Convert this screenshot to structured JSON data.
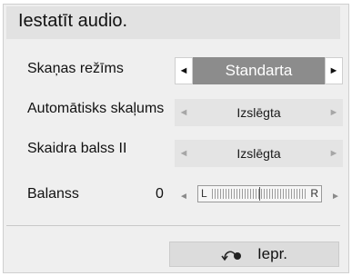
{
  "dialog": {
    "title": "Iestatīt audio."
  },
  "settings": [
    {
      "label": "Skaņas režīms",
      "value": "Standarta",
      "active": true
    },
    {
      "label": "Automātisks skaļums",
      "value": "Izslēgta",
      "active": false
    },
    {
      "label": "Skaidra balss II",
      "value": "Izslēgta",
      "active": false
    }
  ],
  "balance": {
    "label": "Balanss",
    "value": "0",
    "left_label": "L",
    "right_label": "R"
  },
  "arrows": {
    "left": "◄",
    "right": "►"
  },
  "footer": {
    "back_label": "Iepr.",
    "back_icon": "return-arrow-icon"
  },
  "colors": {
    "active_value_bg": "#8c8c8c",
    "dim_bg": "#e4e4e4",
    "dialog_bg": "#efefef",
    "title_bg": "#e2e2e2"
  }
}
